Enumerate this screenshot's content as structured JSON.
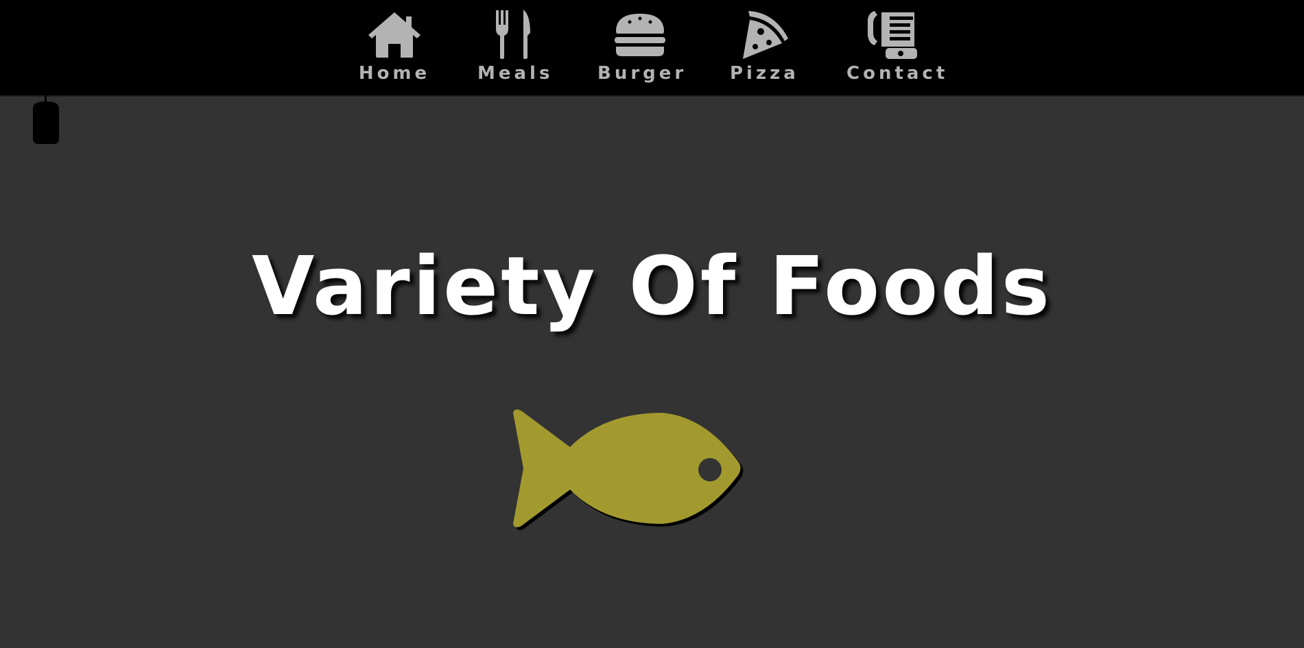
{
  "nav": {
    "items": [
      {
        "label": "Home",
        "icon": "home-icon"
      },
      {
        "label": "Meals",
        "icon": "utensils-icon"
      },
      {
        "label": "Burger",
        "icon": "burger-icon"
      },
      {
        "label": "Pizza",
        "icon": "pizza-slice-icon"
      },
      {
        "label": "Contact",
        "icon": "phone-fax-icon"
      }
    ]
  },
  "scroll_indicator": {
    "icon": "mouse-icon"
  },
  "hero": {
    "title": "Variety Of Foods",
    "icon": "fish-icon"
  },
  "colors": {
    "header_bg": "#000000",
    "page_bg": "#333333",
    "nav_text": "#b3b3b3",
    "title_text": "#ffffff",
    "fish_fill": "#a39a2f"
  }
}
